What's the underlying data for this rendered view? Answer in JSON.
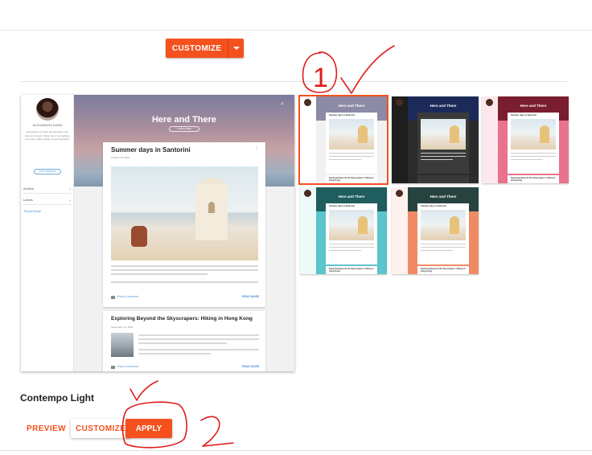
{
  "toolbar": {
    "customize_label": "CUSTOMIZE"
  },
  "preview": {
    "author": "ALEXANDRA DUNN",
    "bio": "Alexandra is a writer and illustrator who lives and travels. When she's not working, she loves coffee, hiking, and photography.",
    "visit_label": "VISIT PROFILE",
    "nav": [
      {
        "label": "Archive"
      },
      {
        "label": "Labels"
      }
    ],
    "report_label": "Report Abuse",
    "blog_title": "Here and There",
    "subscribe_label": "SUBSCRIBE",
    "posts": [
      {
        "title": "Summer days in Santorini",
        "date": "October 19, 2016",
        "comment": "Post a Comment",
        "more": "READ MORE"
      },
      {
        "title": "Exploring Beyond the Skyscrapers: Hiking in Hong Kong",
        "date": "September 12, 2016",
        "comment": "Post a Comment",
        "more": "READ MORE"
      }
    ]
  },
  "thumbs": [
    {
      "title": "Here and There",
      "side": "#ffffff",
      "banner": "#8c8aa6",
      "bg": "#f1f1f1",
      "card": "#ffffff",
      "selected": true
    },
    {
      "title": "Here and There",
      "side": "#1e1e1e",
      "banner": "#1c2a5a",
      "bg": "#2b2b2b",
      "card": "#3a3a3a",
      "selected": false
    },
    {
      "title": "Here and There",
      "side": "#fce8ec",
      "banner": "#7a1d31",
      "bg": "#e9738d",
      "card": "#ffffff",
      "selected": false
    },
    {
      "title": "Here and There",
      "side": "#eefafa",
      "banner": "#1f5d5e",
      "bg": "#5cc4cc",
      "card": "#ffffff",
      "selected": false
    },
    {
      "title": "Here and There",
      "side": "#fff2ee",
      "banner": "#27433f",
      "bg": "#f08a64",
      "card": "#ffffff",
      "selected": false
    }
  ],
  "theme": {
    "name": "Contempo Light",
    "preview_label": "PREVIEW",
    "customize_label": "CUSTOMIZE",
    "apply_label": "APPLY"
  },
  "annotations": {
    "one": "1",
    "two": "2"
  },
  "colors": {
    "accent": "#f4511e",
    "annotation": "#e11b1b"
  }
}
